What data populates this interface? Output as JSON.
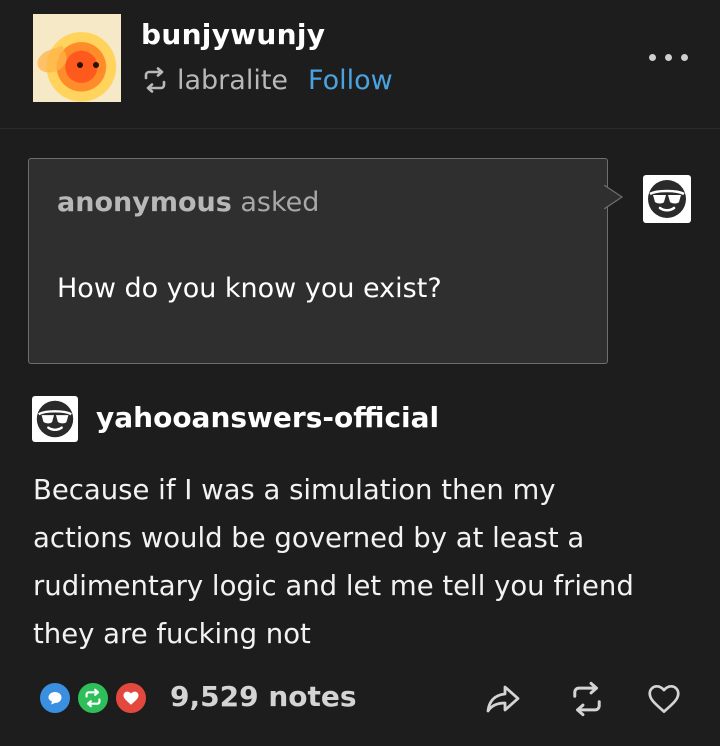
{
  "post": {
    "author": "bunjywunjy",
    "reblog_from": "labralite",
    "follow_label": "Follow"
  },
  "ask": {
    "asker": "anonymous",
    "asked_label": "asked",
    "question": "How do you know you exist?"
  },
  "answer": {
    "answerer": "yahooanswers-official",
    "lines": [
      "Because if I was a simulation then my",
      "actions would be governed by at least a",
      "rudimentary logic and let me tell you friend",
      "they are fucking not"
    ]
  },
  "footer": {
    "notes": "9,529 notes"
  },
  "icons": {
    "more": "more-options-icon",
    "reblog": "reblog-icon",
    "share": "share-icon",
    "like": "heart-icon",
    "comment_badge": "comment-bubble-icon",
    "reblog_badge": "reblog-badge-icon",
    "like_badge": "heart-badge-icon"
  },
  "colors": {
    "background": "#1d1d1d",
    "link": "#4aa3df",
    "comment_badge": "#3a8fe0",
    "reblog_badge": "#2fbf5a",
    "like_badge": "#e2483d"
  }
}
